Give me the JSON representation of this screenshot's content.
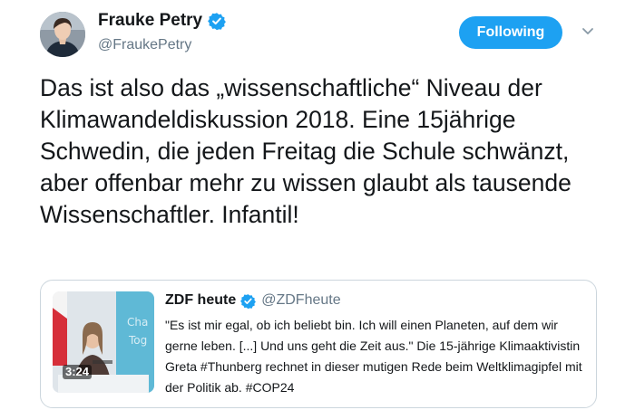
{
  "author": {
    "name": "Frauke Petry",
    "handle": "@FraukePetry",
    "verified": true
  },
  "actions": {
    "follow_label": "Following",
    "more_icon": "chevron-down-icon"
  },
  "tweet": {
    "text": "Das ist also das „wissenschaftliche“ Niveau der Klimawandeldiskussion 2018. Eine 15jährige Schwedin, die jeden Freitag die Schule schwänzt, aber offenbar mehr zu wissen glaubt als tausende Wissenschaftler. Infantil!"
  },
  "quoted": {
    "name": "ZDF heute",
    "handle": "@ZDFheute",
    "verified": true,
    "text": "\"Es ist mir egal, ob ich beliebt bin. Ich will einen Planeten, auf dem wir gerne leben. [...] Und uns geht die Zeit aus.\" Die 15-jährige Klimaaktivistin Greta #Thunberg rechnet in dieser mutigen Rede beim Weltklimagipfel mit der Politik ab.  #COP24",
    "video_time": "3:24"
  },
  "colors": {
    "accent": "#1da1f2",
    "text": "#14171a",
    "muted": "#657786",
    "border": "#ccd6dd"
  }
}
